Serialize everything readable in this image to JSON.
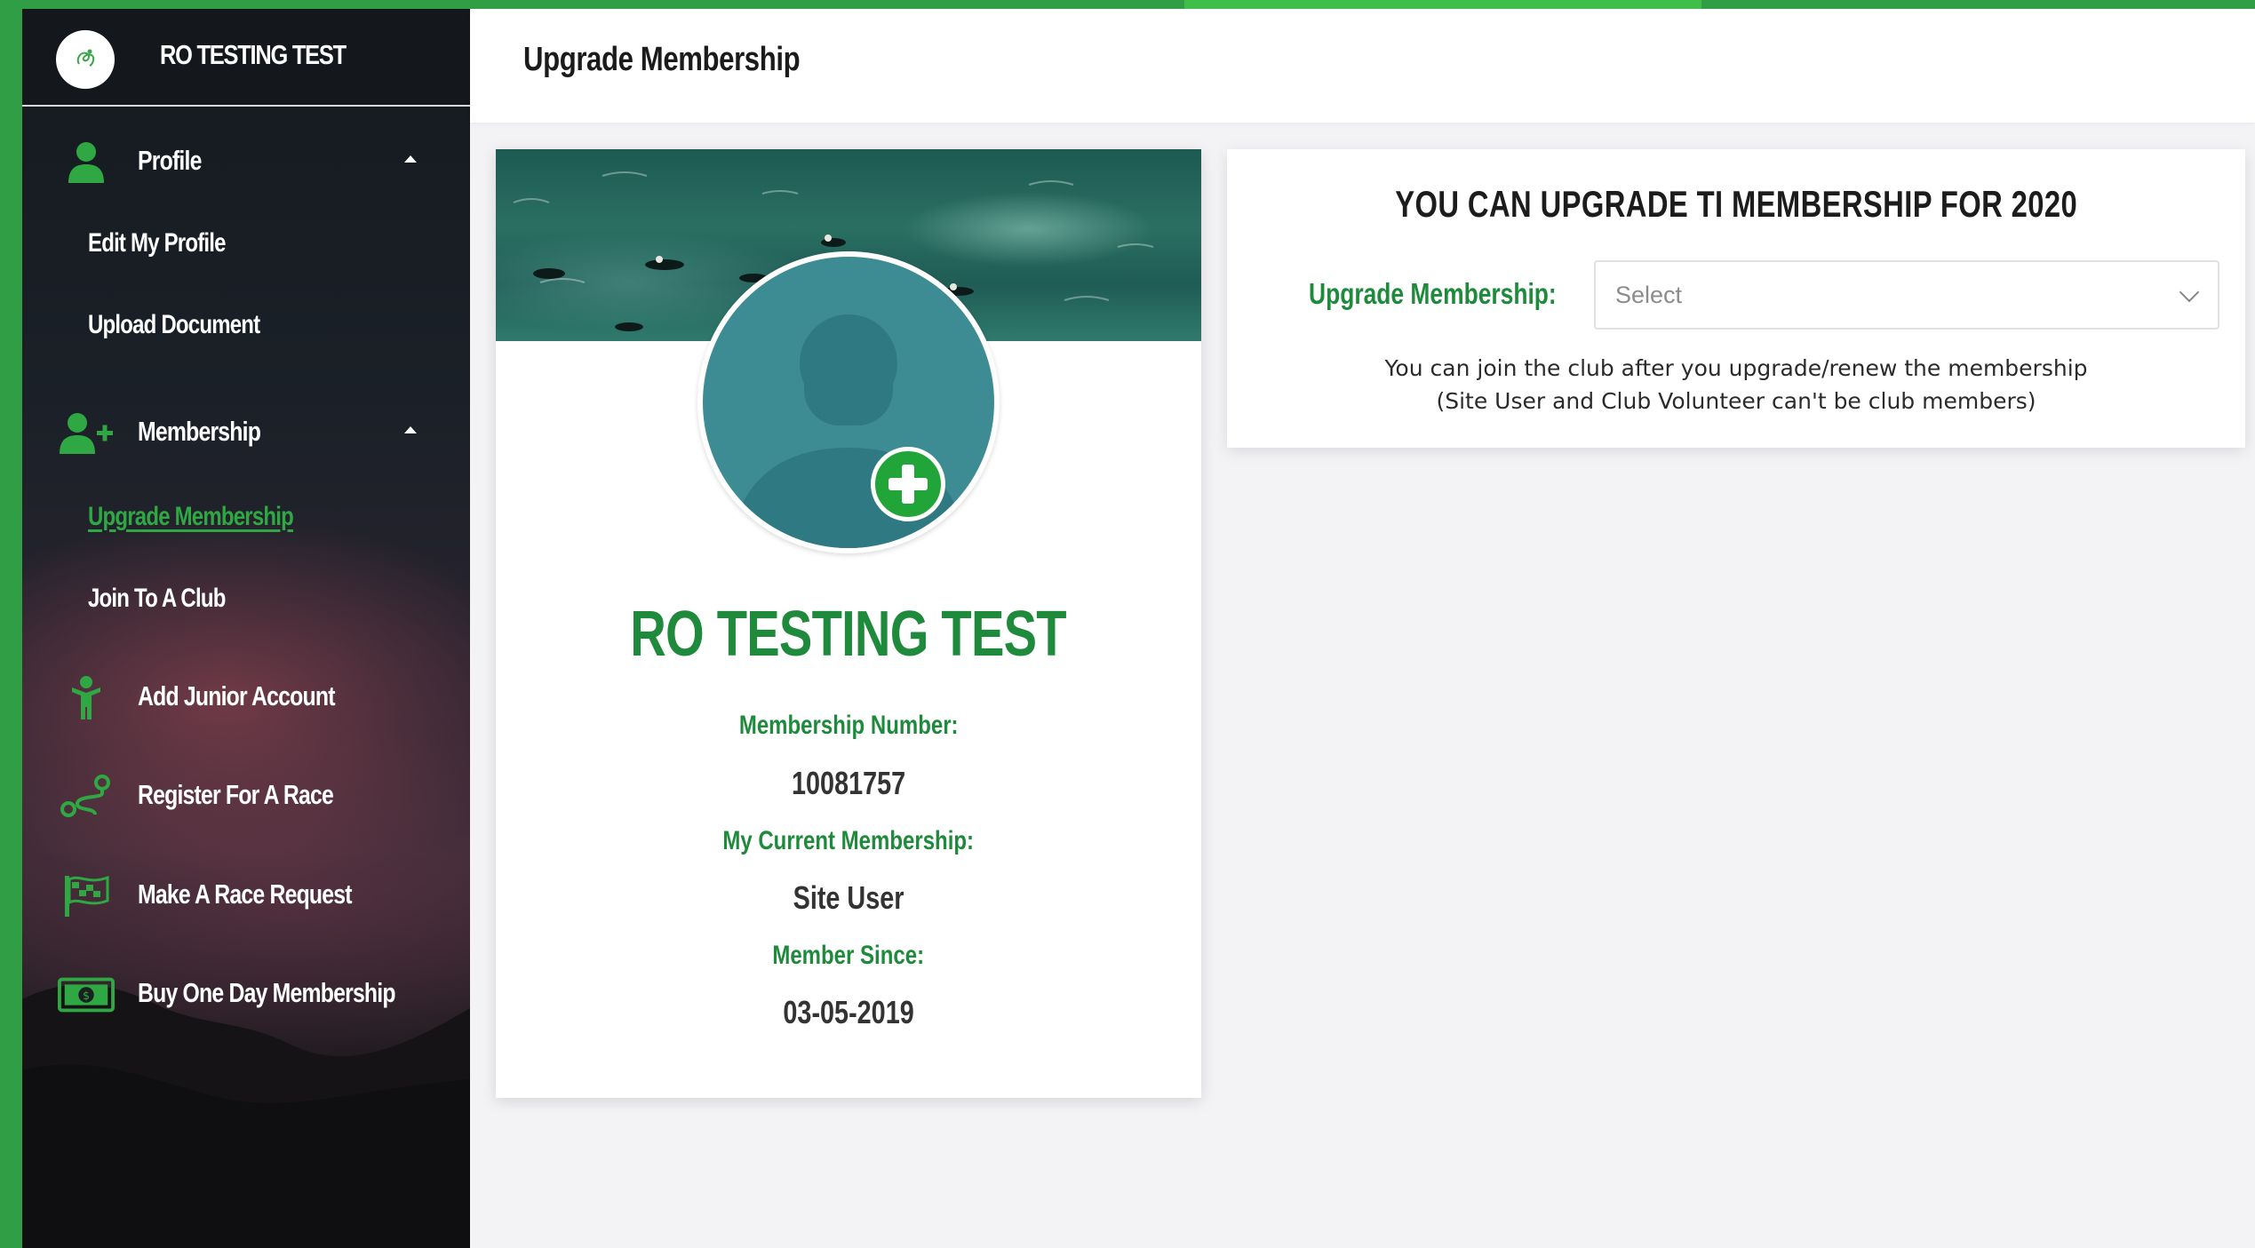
{
  "sidebar": {
    "app_title": "RO TESTING TEST",
    "profile": {
      "label": "Profile",
      "sub": [
        "Edit My Profile",
        "Upload Document"
      ]
    },
    "membership": {
      "label": "Membership",
      "sub": [
        "Upgrade Membership",
        "Join To A Club"
      ]
    },
    "items": [
      "Add Junior Account",
      "Register For A Race",
      "Make A Race Request",
      "Buy One Day Membership"
    ]
  },
  "header": {
    "title": "Upgrade Membership"
  },
  "profile_card": {
    "name": "RO TESTING TEST",
    "membership_number_label": "Membership Number:",
    "membership_number": "10081757",
    "current_membership_label": "My Current Membership:",
    "current_membership": "Site User",
    "member_since_label": "Member Since:",
    "member_since": "03-05-2019"
  },
  "upgrade_panel": {
    "heading": "YOU CAN UPGRADE TI MEMBERSHIP FOR 2020",
    "field_label": "Upgrade Membership:",
    "select_placeholder": "Select",
    "note_line1": "You can join the club after you upgrade/renew the membership",
    "note_line2": "(Site User and Club Volunteer can't be club members)"
  },
  "colors": {
    "brand_green": "#1f8a3c",
    "accent_green": "#2fa843",
    "strip_green": "#2f9e44"
  }
}
